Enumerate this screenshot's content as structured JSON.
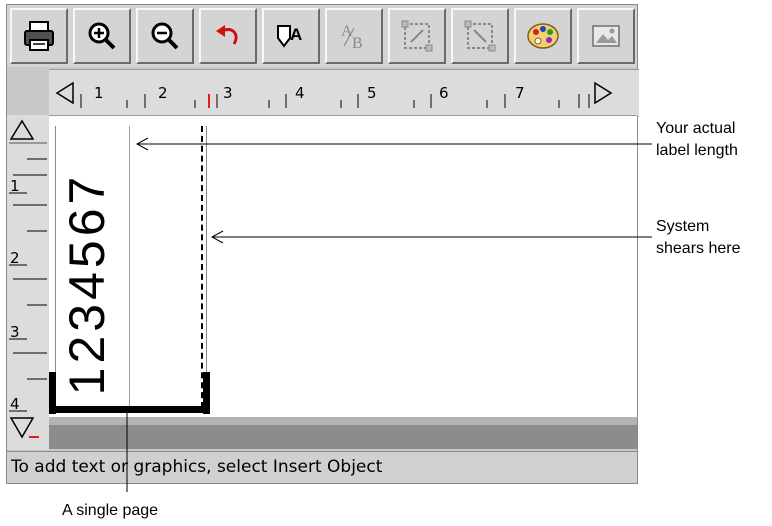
{
  "toolbar": {
    "buttons": [
      {
        "name": "print",
        "icon": "printer-icon"
      },
      {
        "name": "zoom-in",
        "icon": "zoom-in-icon"
      },
      {
        "name": "zoom-out",
        "icon": "zoom-out-icon"
      },
      {
        "name": "undo",
        "icon": "undo-icon"
      },
      {
        "name": "text-format",
        "icon": "text-format-icon"
      },
      {
        "name": "subscript",
        "icon": "subscript-icon"
      },
      {
        "name": "frame-1",
        "icon": "frame-icon"
      },
      {
        "name": "frame-2",
        "icon": "frame-icon"
      },
      {
        "name": "palette",
        "icon": "palette-icon"
      },
      {
        "name": "picture",
        "icon": "picture-icon"
      }
    ]
  },
  "ruler": {
    "h_numbers": [
      "1",
      "2",
      "3",
      "4",
      "5",
      "6",
      "7"
    ],
    "v_numbers": [
      "1",
      "2",
      "3",
      "4"
    ]
  },
  "label": {
    "text": "1234567"
  },
  "status_bar": {
    "text": "To add text or graphics, select Insert Object"
  },
  "annotations": {
    "label_length": [
      "Your actual",
      "label length"
    ],
    "shear": [
      "System",
      "shears here"
    ],
    "single_page": "A single page"
  },
  "colors": {
    "ruler_marker": "#e02020",
    "window_gray": "#c8c8c8",
    "canvas": "#ffffff"
  }
}
